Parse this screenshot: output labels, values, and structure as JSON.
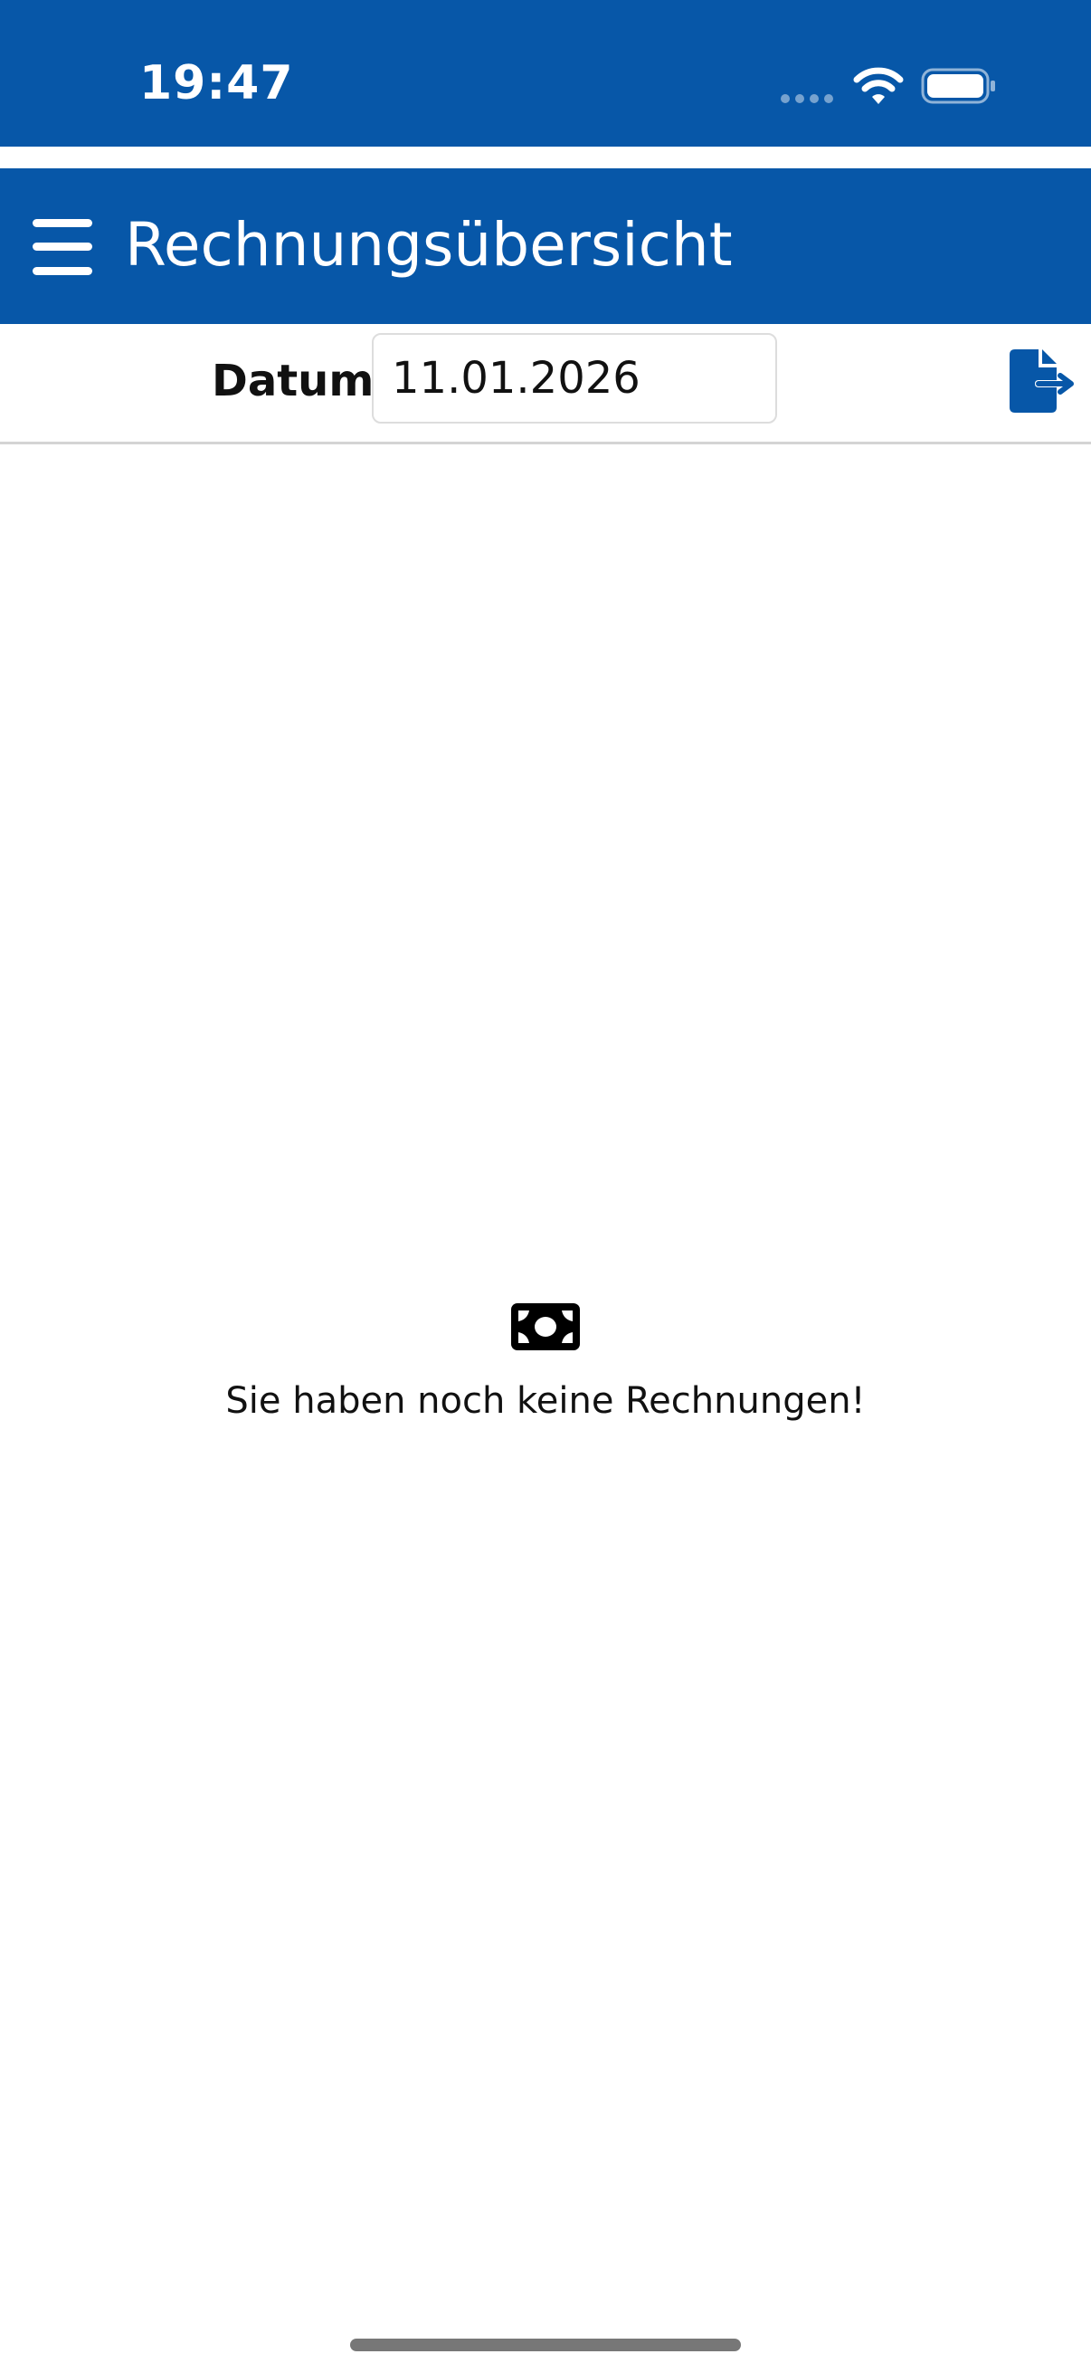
{
  "status_bar": {
    "time": "19:47"
  },
  "header": {
    "title": "Rechnungsübersicht",
    "menu_icon": "hamburger-menu-icon"
  },
  "filter": {
    "date_label": "Datum",
    "date_value": "11.01.2026",
    "export_icon": "file-export-icon"
  },
  "empty_state": {
    "icon": "money-bill-icon",
    "message": "Sie haben noch keine Rechnungen!"
  },
  "colors": {
    "brand_blue": "#0757a8",
    "text": "#111111",
    "divider": "#d4d4d4"
  }
}
